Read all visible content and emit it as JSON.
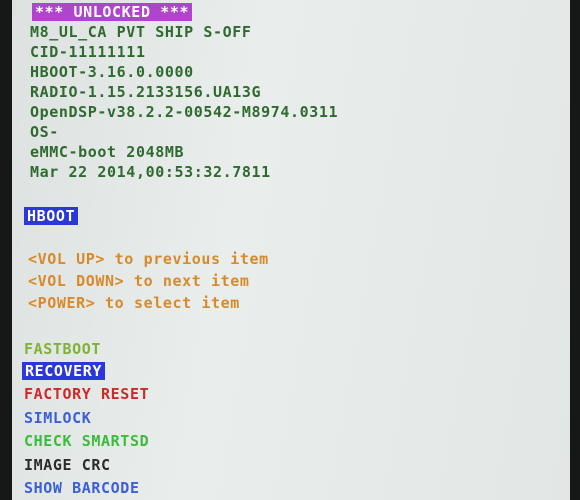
{
  "header": {
    "unlocked_badge": "*** UNLOCKED ***",
    "lines": [
      "M8_UL_CA PVT SHIP S-OFF",
      "CID-11111111",
      "HBOOT-3.16.0.0000",
      "RADIO-1.15.2133156.UA13G",
      "OpenDSP-v38.2.2-00542-M8974.0311",
      "OS-",
      "eMMC-boot 2048MB",
      "Mar 22 2014,00:53:32.7811"
    ]
  },
  "mode_title": "HBOOT",
  "instructions": [
    "<VOL UP> to previous item",
    "<VOL DOWN> to next item",
    "<POWER> to select item"
  ],
  "menu": {
    "selected": "RECOVERY",
    "items": [
      {
        "label": "FASTBOOT",
        "color": "#7fb236"
      },
      {
        "label": "RECOVERY",
        "color": "#ffffff"
      },
      {
        "label": "FACTORY RESET",
        "color": "#cc2a2a"
      },
      {
        "label": "SIMLOCK",
        "color": "#3b5fd6"
      },
      {
        "label": "CHECK SMARTSD",
        "color": "#3dbb3d"
      },
      {
        "label": "IMAGE CRC",
        "color": "#2c2c2c"
      },
      {
        "label": "SHOW BARCODE",
        "color": "#3b5fd6"
      }
    ]
  },
  "colors": {
    "status_text": "#2f6a2f",
    "unlocked_bg": "#b044cc",
    "selection_bg": "#2b38d8",
    "instruction_text": "#d88a2a"
  }
}
